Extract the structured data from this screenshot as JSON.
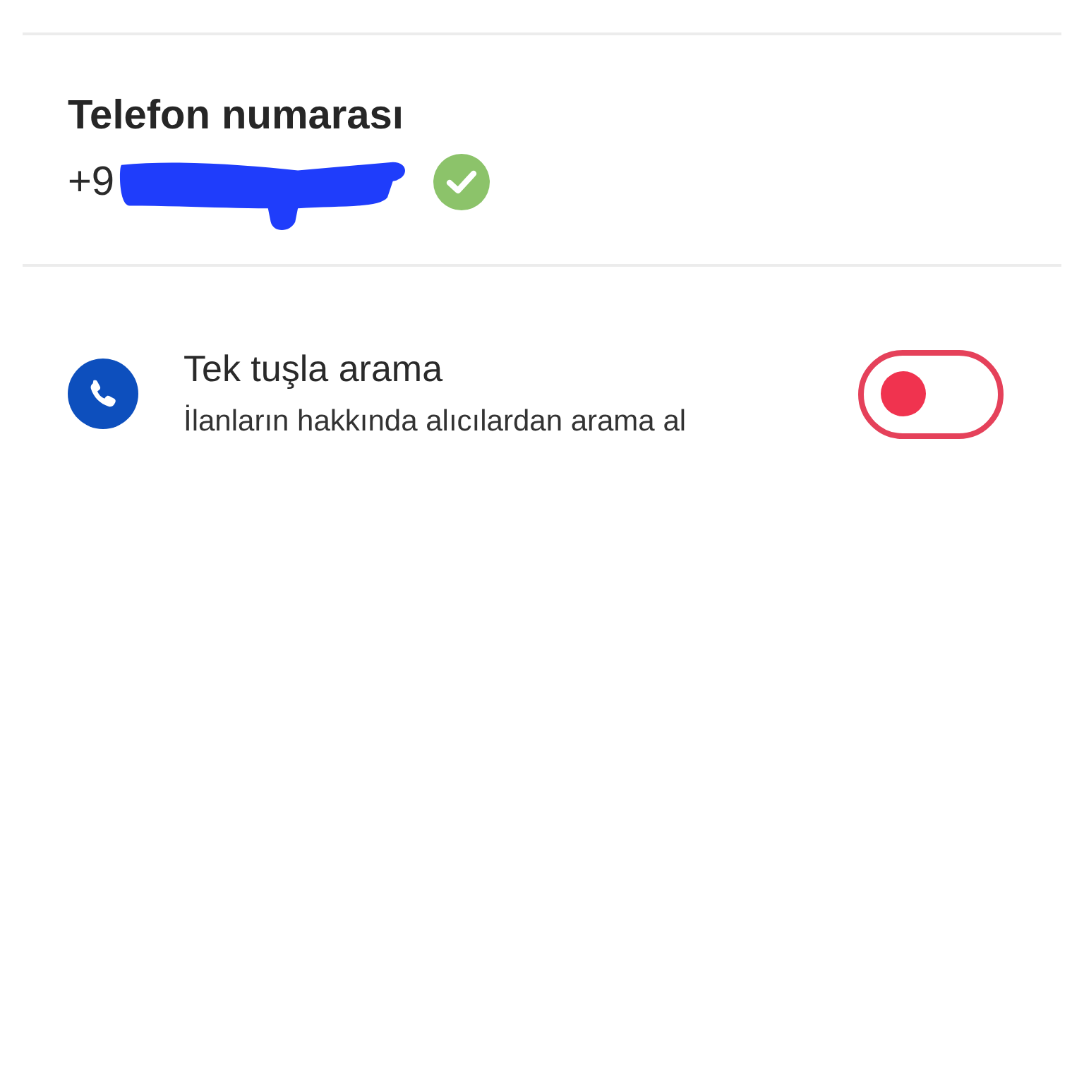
{
  "phone_section": {
    "title": "Telefon numarası",
    "phone_number": "+9",
    "redacted": true,
    "verified": true
  },
  "settings": [
    {
      "kind": "toggle",
      "title": "Tek tuşla arama",
      "subtitle": "İlanların hakkında alıcılardan arama al",
      "on": false
    }
  ]
}
